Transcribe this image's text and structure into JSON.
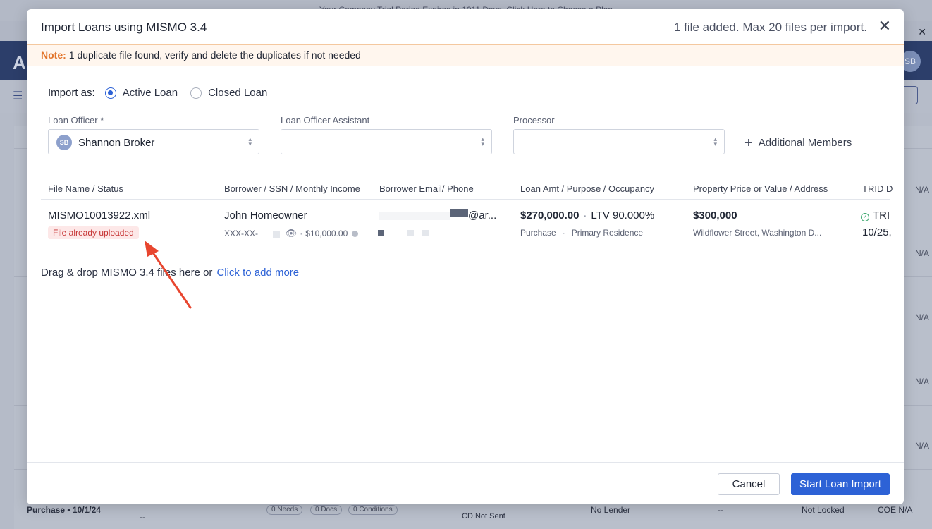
{
  "background": {
    "banner_text": "Your Company Trial Period Expires in 1011 Days. Click Here to Choose a Plan",
    "header_letter": "A",
    "avatar_initials": "SB",
    "right_col_text": "N/A",
    "bottom_row": {
      "purpose": "Purchase • 10/1/24",
      "dash": "--",
      "needs": "0 Needs",
      "docs": "0 Docs",
      "conditions": "0 Conditions",
      "cd_status": "CD Not Sent",
      "lender": "No Lender",
      "dash2": "--",
      "lock": "Not Locked",
      "coe": "COE N/A"
    }
  },
  "modal": {
    "title": "Import Loans using MISMO 3.4",
    "file_count": "1 file added. Max 20 files per import.",
    "close_glyph": "✕",
    "note_label": "Note:",
    "note_text": "1 duplicate file found, verify and delete the duplicates if not needed",
    "import_as": {
      "label": "Import as:",
      "options": [
        "Active Loan",
        "Closed Loan"
      ],
      "selected": "Active Loan"
    },
    "fields": {
      "loan_officer_label": "Loan Officer *",
      "loan_officer_value": "Shannon Broker",
      "loan_officer_initials": "SB",
      "assistant_label": "Loan Officer Assistant",
      "assistant_value": "",
      "processor_label": "Processor",
      "processor_value": ""
    },
    "additional_members": "Additional Members",
    "table": {
      "columns": [
        "File Name / Status",
        "Borrower / SSN / Monthly Income",
        "Borrower Email/ Phone",
        "Loan Amt / Purpose / Occupancy",
        "Property Price or Value / Address",
        "TRID D"
      ],
      "rows": [
        {
          "file_name": "MISMO10013922.xml",
          "status": "File already uploaded",
          "borrower": "John Homeowner",
          "ssn": "XXX-XX-",
          "income": "$10,000.00",
          "email_suffix": "@ar...",
          "loan_amt": "$270,000.00",
          "ltv": "LTV 90.000%",
          "purpose": "Purchase",
          "occupancy": "Primary Residence",
          "property_value": "$300,000",
          "address": "Wildflower Street, Washington D...",
          "trid_status": "TRI",
          "trid_date": "10/25,"
        }
      ]
    },
    "dropzone_text": "Drag & drop MISMO 3.4 files here or",
    "dropzone_link": "Click to add more",
    "cancel_label": "Cancel",
    "start_label": "Start Loan Import"
  },
  "colors": {
    "accent": "#2d62d6",
    "note_orange": "#e2742a",
    "error_red": "#c53030",
    "annotation_arrow": "#e8462f"
  }
}
